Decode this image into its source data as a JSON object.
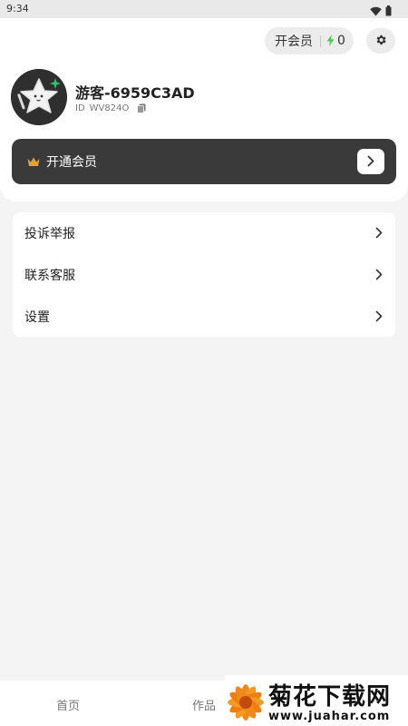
{
  "status_bar": {
    "time": "9:34",
    "icons": [
      "wifi-icon",
      "battery-icon"
    ]
  },
  "header": {
    "vip_pill": {
      "label": "开会员",
      "count": "0",
      "icon": "lightning-icon",
      "accent": "#4cc64a"
    },
    "settings_icon": "gear-icon"
  },
  "profile": {
    "username": "游客-6959C3AD",
    "id_prefix": "ID",
    "id_value": "WV824O",
    "avatar_icon": "star-mascot-icon"
  },
  "member_banner": {
    "label": "开通会员",
    "icon": "crown-icon",
    "crown_color": "#e0a43a",
    "background": "#3a3a3a"
  },
  "menu": {
    "items": [
      {
        "label": "投诉举报"
      },
      {
        "label": "联系客服"
      },
      {
        "label": "设置"
      }
    ]
  },
  "bottom_nav": {
    "items": [
      {
        "label": "首页"
      },
      {
        "label": "作品"
      }
    ]
  },
  "watermark": {
    "title": "菊花下载网",
    "url": "www.juahar.com"
  }
}
